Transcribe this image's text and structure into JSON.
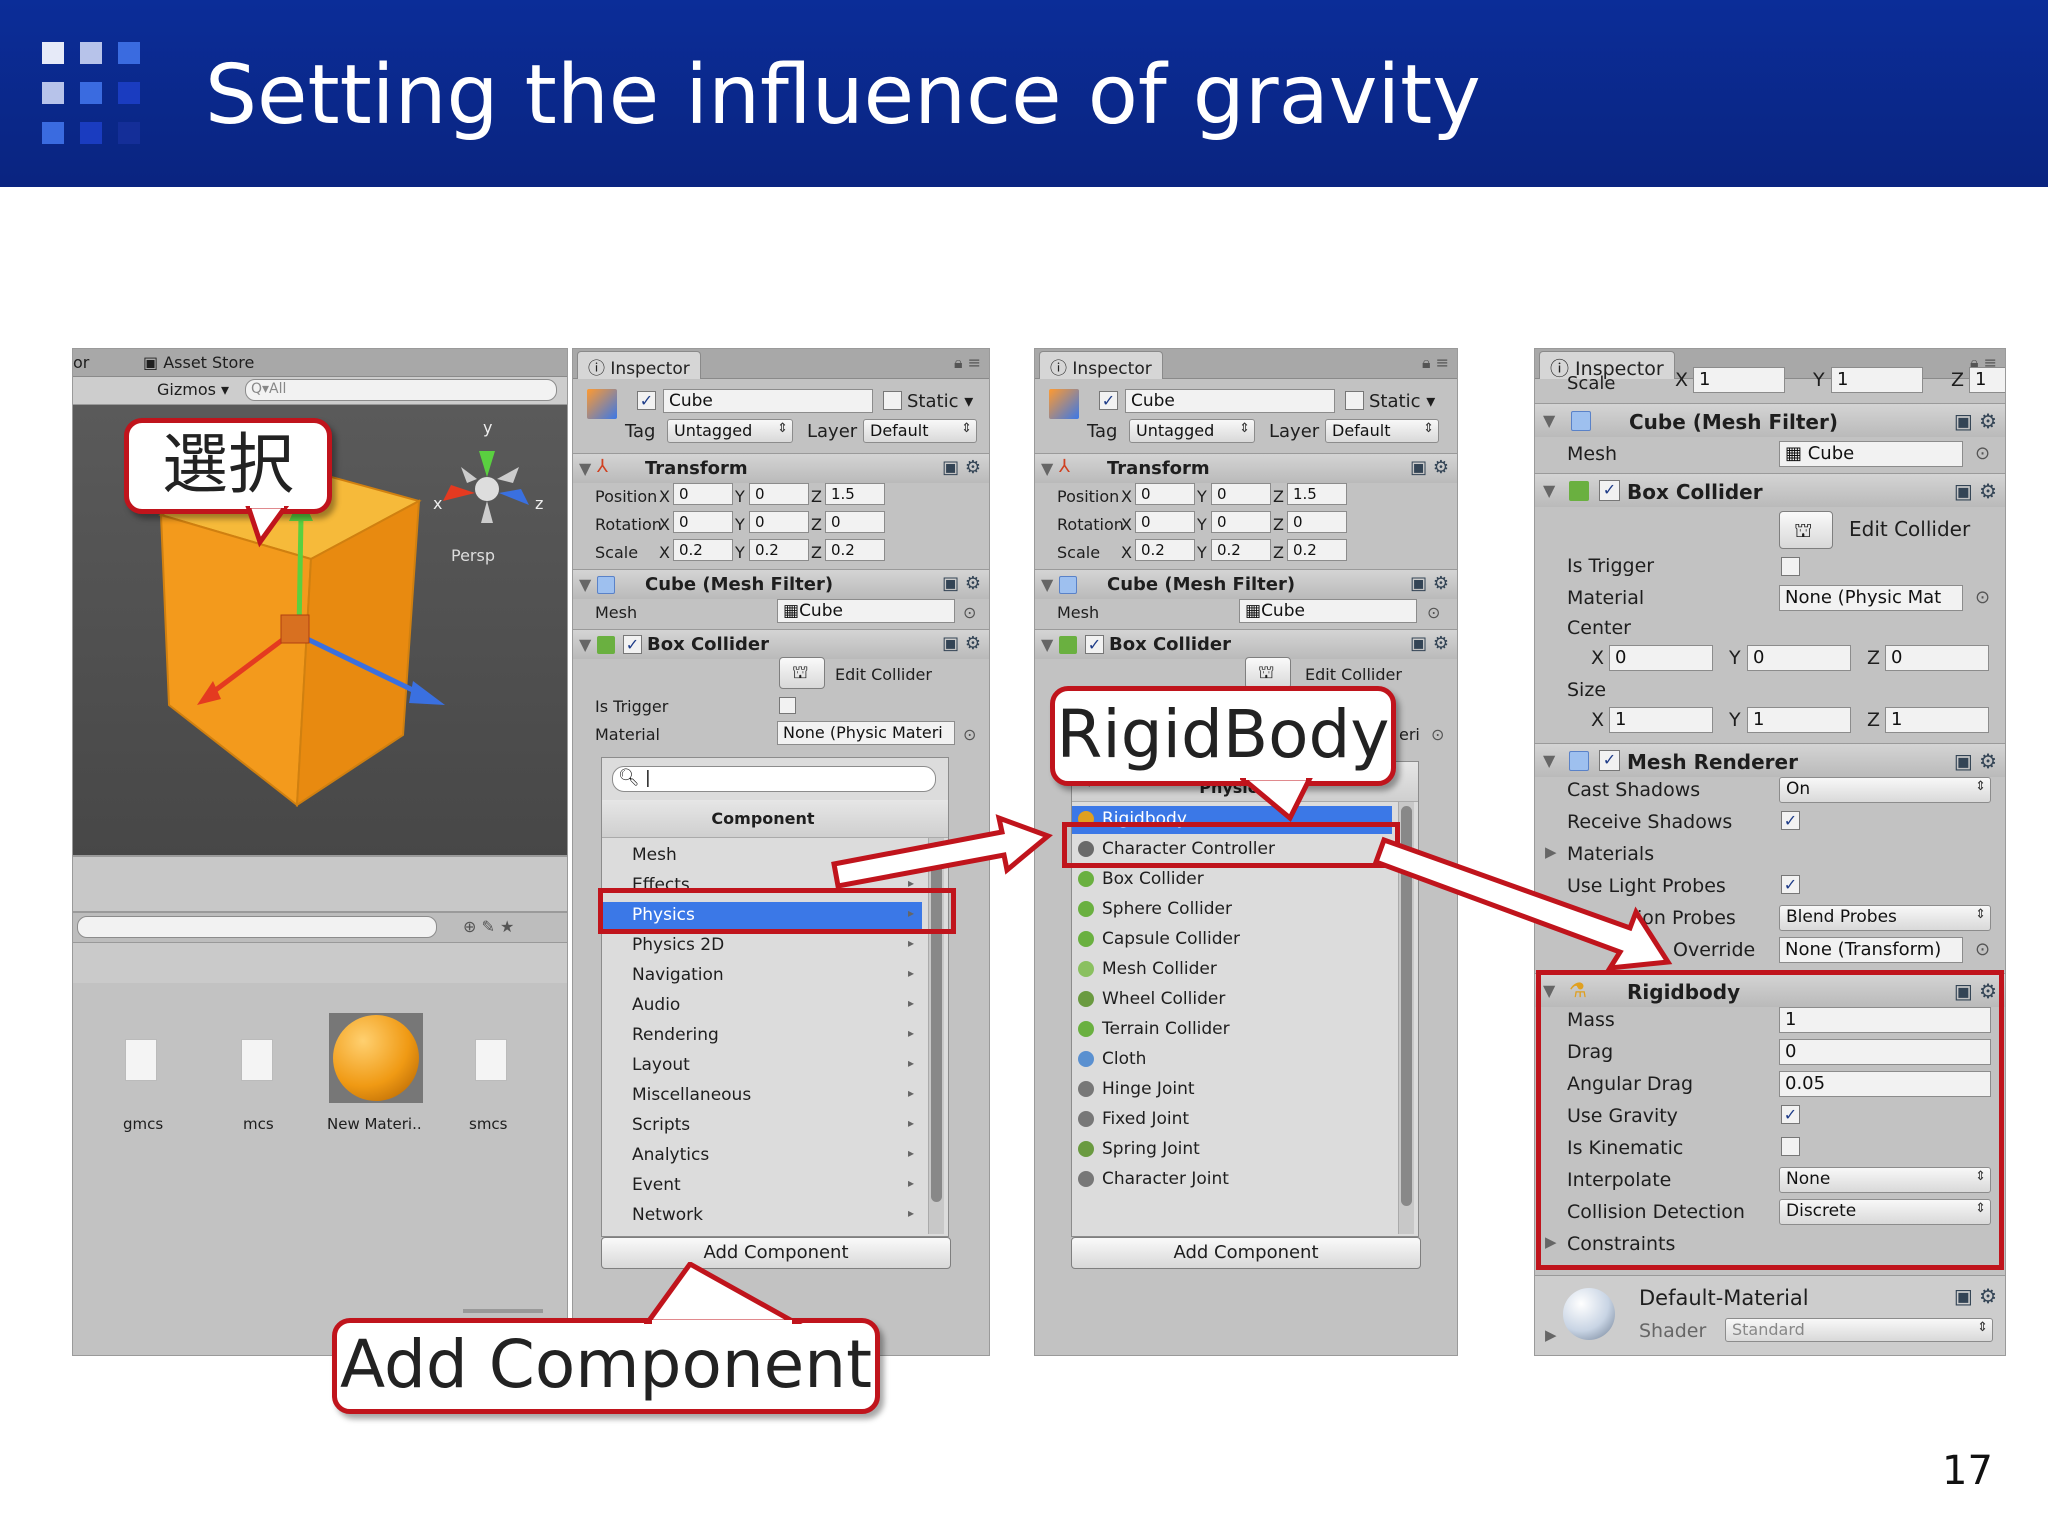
{
  "slide": {
    "title": "Setting the influence of gravity",
    "page_number": "17"
  },
  "callouts": {
    "select": "選択",
    "add_component": "Add Component",
    "rigidbody": "RigidBody"
  },
  "scene": {
    "tab": "Asset Store",
    "tab_prefix": "or",
    "gizmos": "Gizmos",
    "search_placeholder": "Q▾All",
    "persp": "Persp",
    "axis_x": "x",
    "axis_y": "y",
    "axis_z": "z"
  },
  "assets": [
    {
      "label": "gmcs"
    },
    {
      "label": "mcs"
    },
    {
      "label": "New Materi.."
    },
    {
      "label": "smcs"
    }
  ],
  "inspector": {
    "tab": "Inspector",
    "object_name": "Cube",
    "static_label": "Static",
    "tag_label": "Tag",
    "tag_value": "Untagged",
    "layer_label": "Layer",
    "layer_value": "Default",
    "transform": {
      "title": "Transform",
      "position_label": "Position",
      "rotation_label": "Rotation",
      "scale_label": "Scale",
      "x": "X",
      "y": "Y",
      "z": "Z",
      "position": [
        "0",
        "0",
        "1.5"
      ],
      "rotation": [
        "0",
        "0",
        "0"
      ],
      "scale": [
        "0.2",
        "0.2",
        "0.2"
      ]
    },
    "mesh_filter": {
      "title": "Cube (Mesh Filter)",
      "mesh_label": "Mesh",
      "mesh_value": "Cube"
    },
    "box_collider": {
      "title": "Box Collider",
      "edit_collider": "Edit Collider",
      "is_trigger": "Is Trigger",
      "material_label": "Material",
      "material_value": "None (Physic Materi",
      "material_value_short": "None (Physic Mat",
      "center_label": "Center",
      "center": [
        "0",
        "0",
        "0"
      ],
      "size_label": "Size",
      "size": [
        "1",
        "1",
        "1"
      ],
      "partial_material": "eri"
    },
    "add_component": "Add Component",
    "component_menu": {
      "header": "Component",
      "items": [
        "Mesh",
        "Effects",
        "Physics",
        "Physics 2D",
        "Navigation",
        "Audio",
        "Rendering",
        "Layout",
        "Miscellaneous",
        "Scripts",
        "Analytics",
        "Event",
        "Network"
      ],
      "selected": "Physics"
    },
    "physics_menu": {
      "header": "Physics",
      "items": [
        "Rigidbody",
        "Character Controller",
        "Box Collider",
        "Sphere Collider",
        "Capsule Collider",
        "Mesh Collider",
        "Wheel Collider",
        "Terrain Collider",
        "Cloth",
        "Hinge Joint",
        "Fixed Joint",
        "Spring Joint",
        "Character Joint"
      ],
      "selected": "Rigidbody"
    }
  },
  "inspector3": {
    "scale_row": "Scale",
    "scale_vals": [
      "1",
      "1",
      "1"
    ],
    "mesh_renderer": {
      "title": "Mesh Renderer",
      "cast_shadows": "Cast Shadows",
      "cast_value": "On",
      "receive_shadows": "Receive Shadows",
      "materials": "Materials",
      "use_light_probes": "Use Light Probes",
      "reflection_probes": "ion Probes",
      "reflection_prefix": "r",
      "reflection_value": "Blend Probes",
      "anchor_override": "Override",
      "anchor_value": "None (Transform)"
    },
    "rigidbody": {
      "title": "Rigidbody",
      "mass_label": "Mass",
      "mass": "1",
      "drag_label": "Drag",
      "drag": "0",
      "angular_drag_label": "Angular Drag",
      "angular_drag": "0.05",
      "use_gravity_label": "Use Gravity",
      "is_kinematic_label": "Is Kinematic",
      "interpolate_label": "Interpolate",
      "interpolate": "None",
      "collision_label": "Collision Detection",
      "collision": "Discrete",
      "constraints_label": "Constraints"
    },
    "material": {
      "name": "Default-Material",
      "shader_label": "Shader",
      "shader_value": "Standard"
    }
  },
  "colors": {
    "header_blue": "#0b2d98",
    "callout_red": "#c0141c",
    "selection_blue": "#3b78e7",
    "cube_orange": "#f0a020"
  },
  "icons": {
    "scene_gizmo": "axis-gizmo-icon",
    "cube": "cube-icon",
    "transform": "transform-icon",
    "settings": "gear-icon",
    "help": "help-book-icon",
    "lock": "lock-icon",
    "rigidbody": "rigidbody-icon"
  }
}
